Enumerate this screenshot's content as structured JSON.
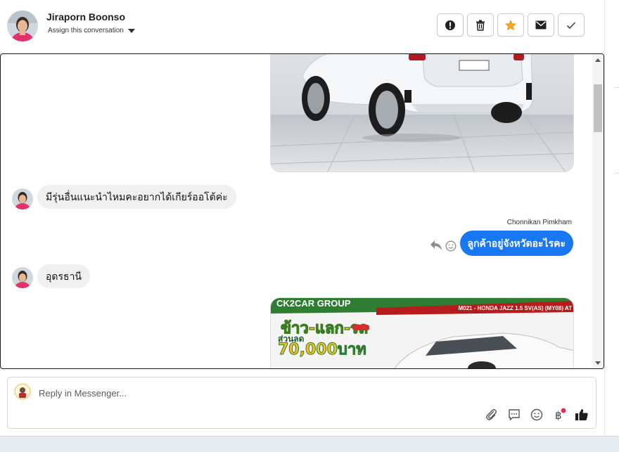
{
  "header": {
    "contact_name": "Jiraporn Boonso",
    "assign_label": "Assign this conversation",
    "actions": [
      {
        "name": "mark-spam-button",
        "icon": "exclamation-circle-icon"
      },
      {
        "name": "delete-button",
        "icon": "trash-icon"
      },
      {
        "name": "star-button",
        "icon": "star-icon",
        "color": "#f5a623"
      },
      {
        "name": "mark-unread-button",
        "icon": "envelope-icon"
      },
      {
        "name": "mark-done-button",
        "icon": "checkmark-icon"
      }
    ]
  },
  "thread": {
    "messages": [
      {
        "type": "image",
        "direction": "outgoing",
        "subject": "white hatchback car rear view"
      },
      {
        "type": "text",
        "direction": "incoming",
        "text": "มีรุ่นอื่นแนะนำไหมคะอยากได้เกียร์ออโต้ค่ะ"
      },
      {
        "type": "text",
        "direction": "outgoing",
        "sender": "Chonnikan Pimkham",
        "text": "ลูกค้าอยู่จังหวัดอะไรคะ"
      },
      {
        "type": "text",
        "direction": "incoming",
        "text": "อุดรธานี"
      },
      {
        "type": "image",
        "direction": "outgoing",
        "banner_left": "CK2CAR GROUP",
        "banner_right": "M021 - HONDA JAZZ 1.5 SV(AS) (MY08) AT",
        "promo_line1": "ข้าว-แลก-รถ",
        "promo_line2": "ส่วนลด",
        "promo_line3": "70,000บาท"
      }
    ]
  },
  "composer": {
    "placeholder": "Reply in Messenger...",
    "icons": [
      "paperclip-icon",
      "saved-reply-icon",
      "emoji-icon",
      "baht-payment-icon",
      "thumbs-up-icon"
    ],
    "notification_color": "#f02849"
  },
  "colors": {
    "accent": "#1877f2",
    "incoming_bubble": "#f0f0f0"
  }
}
